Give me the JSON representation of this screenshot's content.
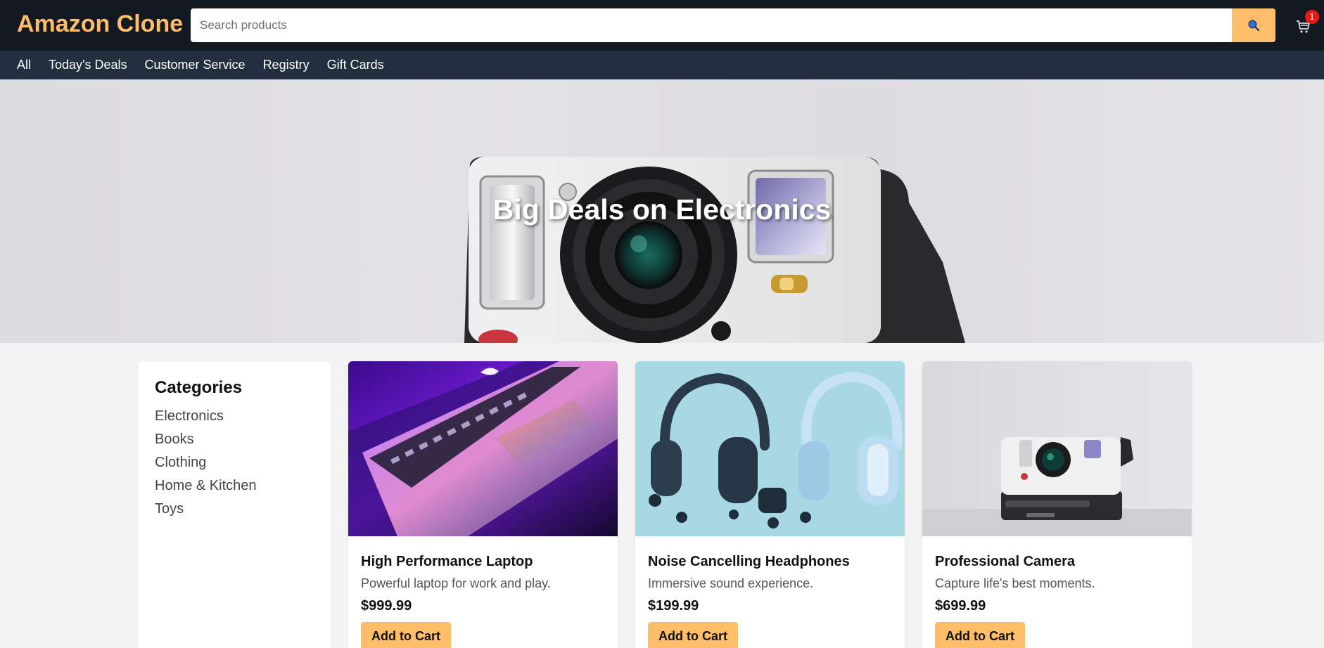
{
  "header": {
    "logo": "Amazon Clone",
    "search_placeholder": "Search products",
    "search_icon": "magnifier-icon",
    "cart_icon": "cart-icon",
    "cart_count": "1"
  },
  "subnav": {
    "items": [
      "All",
      "Today's Deals",
      "Customer Service",
      "Registry",
      "Gift Cards"
    ]
  },
  "hero": {
    "title": "Big Deals on Electronics"
  },
  "sidebar": {
    "title": "Categories",
    "items": [
      "Electronics",
      "Books",
      "Clothing",
      "Home & Kitchen",
      "Toys"
    ]
  },
  "products": [
    {
      "title": "High Performance Laptop",
      "description": "Powerful laptop for work and play.",
      "price": "$999.99",
      "button": "Add to Cart"
    },
    {
      "title": "Noise Cancelling Headphones",
      "description": "Immersive sound experience.",
      "price": "$199.99",
      "button": "Add to Cart"
    },
    {
      "title": "Professional Camera",
      "description": "Capture life's best moments.",
      "price": "$699.99",
      "button": "Add to Cart"
    }
  ],
  "colors": {
    "header_bg": "#131921",
    "subnav_bg": "#232f3e",
    "accent": "#febd69",
    "badge": "#e41b17"
  }
}
